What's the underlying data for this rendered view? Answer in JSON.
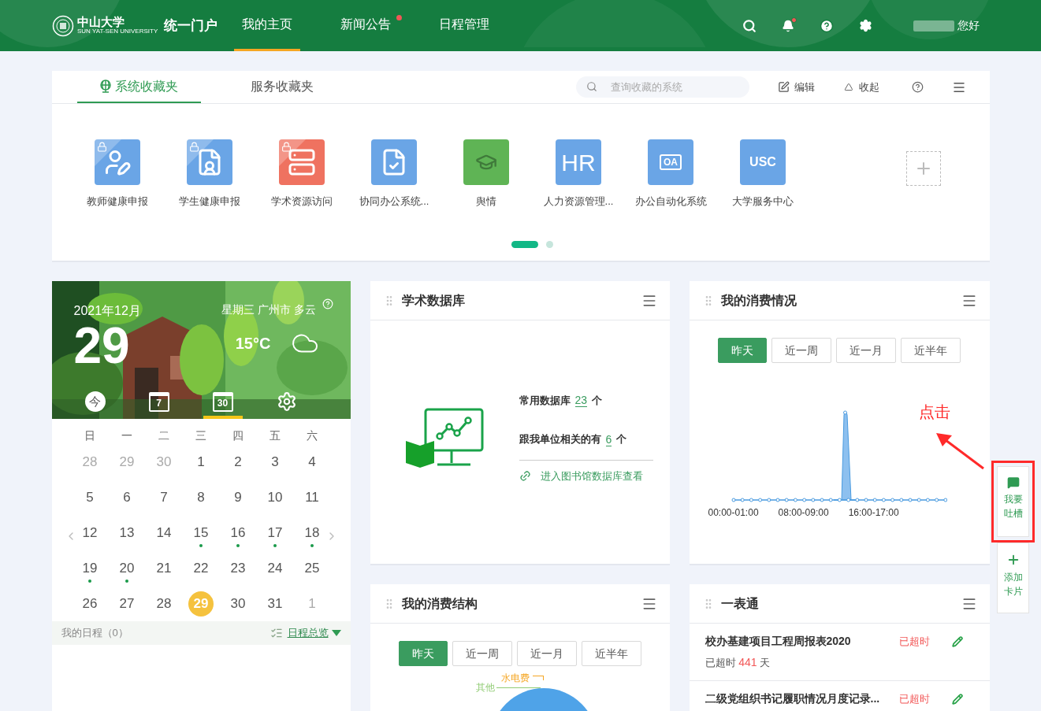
{
  "header": {
    "logo_name": "中山大学",
    "logo_subtitle": "SUN YAT-SEN UNIVERSITY",
    "portal_name": "统一门户",
    "nav": [
      {
        "label": "我的主页",
        "selected": true,
        "badge": false
      },
      {
        "label": "新闻公告",
        "selected": false,
        "badge": true
      },
      {
        "label": "日程管理",
        "selected": false,
        "badge": false
      }
    ],
    "tools": [
      {
        "kind": "search",
        "badge": false
      },
      {
        "kind": "bell",
        "badge": true
      },
      {
        "kind": "help",
        "badge": false
      },
      {
        "kind": "settings",
        "badge": false
      }
    ],
    "greeting": "您好"
  },
  "favorites": {
    "tabs": [
      {
        "label": "系统收藏夹",
        "selected": true
      },
      {
        "label": "服务收藏夹",
        "selected": false
      }
    ],
    "search_placeholder": "查询收藏的系统",
    "actions": [
      {
        "kind": "edit",
        "label": "编辑"
      },
      {
        "kind": "collapse",
        "label": "收起"
      }
    ],
    "apps": [
      {
        "label": "教师健康申报",
        "kind": "teacher",
        "color": "#6aa5e6",
        "locked": true
      },
      {
        "label": "学生健康申报",
        "kind": "student",
        "color": "#6aa5e6",
        "locked": true
      },
      {
        "label": "学术资源访问",
        "kind": "database",
        "color": "#ef7260",
        "locked": true
      },
      {
        "label": "协同办公系统...",
        "kind": "office",
        "color": "#6aa5e6",
        "locked": false
      },
      {
        "label": "舆情",
        "kind": "opinion",
        "color": "#5fb455",
        "locked": false
      },
      {
        "label": "人力资源管理...",
        "kind": "text",
        "glyph": "HR",
        "color": "#6aa5e6",
        "locked": false
      },
      {
        "label": "办公自动化系统",
        "kind": "screen",
        "glyph": "OA",
        "color": "#6aa5e6",
        "locked": false
      },
      {
        "label": "大学服务中心",
        "kind": "text",
        "glyph": "USC",
        "color": "#6aa5e6",
        "locked": false
      }
    ],
    "pages": [
      {
        "selected": true
      },
      {
        "selected": false
      }
    ]
  },
  "calendar": {
    "month": "2021年12月",
    "day": "29",
    "weekday": "星期三",
    "city": "广州市",
    "weather": "多云",
    "temperature": "15°C",
    "views": [
      {
        "kind": "today",
        "glyph": "今",
        "selected": false
      },
      {
        "kind": "week",
        "glyph": "7",
        "selected": false
      },
      {
        "kind": "month",
        "glyph": "30",
        "selected": true
      },
      {
        "kind": "settings",
        "selected": false
      }
    ],
    "weekdays": [
      "日",
      "一",
      "二",
      "三",
      "四",
      "五",
      "六"
    ],
    "weeks": [
      [
        {
          "label": "28",
          "muted": true,
          "dot": false,
          "selected": false
        },
        {
          "label": "29",
          "muted": true,
          "dot": false,
          "selected": false
        },
        {
          "label": "30",
          "muted": true,
          "dot": false,
          "selected": false
        },
        {
          "label": "1",
          "muted": false,
          "dot": false,
          "selected": false
        },
        {
          "label": "2",
          "muted": false,
          "dot": false,
          "selected": false
        },
        {
          "label": "3",
          "muted": false,
          "dot": false,
          "selected": false
        },
        {
          "label": "4",
          "muted": false,
          "dot": false,
          "selected": false
        }
      ],
      [
        {
          "label": "5",
          "muted": false,
          "dot": false,
          "selected": false
        },
        {
          "label": "6",
          "muted": false,
          "dot": false,
          "selected": false
        },
        {
          "label": "7",
          "muted": false,
          "dot": false,
          "selected": false
        },
        {
          "label": "8",
          "muted": false,
          "dot": false,
          "selected": false
        },
        {
          "label": "9",
          "muted": false,
          "dot": false,
          "selected": false
        },
        {
          "label": "10",
          "muted": false,
          "dot": false,
          "selected": false
        },
        {
          "label": "11",
          "muted": false,
          "dot": false,
          "selected": false
        }
      ],
      [
        {
          "label": "12",
          "muted": false,
          "dot": false,
          "selected": false
        },
        {
          "label": "13",
          "muted": false,
          "dot": false,
          "selected": false
        },
        {
          "label": "14",
          "muted": false,
          "dot": false,
          "selected": false
        },
        {
          "label": "15",
          "muted": false,
          "dot": true,
          "selected": false
        },
        {
          "label": "16",
          "muted": false,
          "dot": true,
          "selected": false
        },
        {
          "label": "17",
          "muted": false,
          "dot": true,
          "selected": false
        },
        {
          "label": "18",
          "muted": false,
          "dot": true,
          "selected": false
        }
      ],
      [
        {
          "label": "19",
          "muted": false,
          "dot": true,
          "selected": false
        },
        {
          "label": "20",
          "muted": false,
          "dot": true,
          "selected": false
        },
        {
          "label": "21",
          "muted": false,
          "dot": false,
          "selected": false
        },
        {
          "label": "22",
          "muted": false,
          "dot": false,
          "selected": false
        },
        {
          "label": "23",
          "muted": false,
          "dot": false,
          "selected": false
        },
        {
          "label": "24",
          "muted": false,
          "dot": false,
          "selected": false
        },
        {
          "label": "25",
          "muted": false,
          "dot": false,
          "selected": false
        }
      ],
      [
        {
          "label": "26",
          "muted": false,
          "dot": false,
          "selected": false
        },
        {
          "label": "27",
          "muted": false,
          "dot": false,
          "selected": false
        },
        {
          "label": "28",
          "muted": false,
          "dot": false,
          "selected": false
        },
        {
          "label": "29",
          "muted": false,
          "dot": false,
          "selected": true
        },
        {
          "label": "30",
          "muted": false,
          "dot": false,
          "selected": false
        },
        {
          "label": "31",
          "muted": false,
          "dot": false,
          "selected": false
        },
        {
          "label": "1",
          "muted": true,
          "dot": false,
          "selected": false
        }
      ]
    ],
    "schedule_label": "我的日程（0）",
    "overview_link": "日程总览"
  },
  "database": {
    "title": "学术数据库",
    "stats": [
      {
        "label": "常用数据库",
        "count": "23",
        "unit": "个"
      },
      {
        "label": "跟我单位相关的有",
        "count": "6",
        "unit": "个"
      }
    ],
    "link": "进入图书馆数据库查看"
  },
  "consumption": {
    "title": "我的消费情况",
    "ranges": [
      {
        "label": "昨天",
        "selected": true
      },
      {
        "label": "近一周",
        "selected": false
      },
      {
        "label": "近一月",
        "selected": false
      },
      {
        "label": "近半年",
        "selected": false
      }
    ],
    "x_labels": [
      "00:00-01:00",
      "08:00-09:00",
      "16:00-17:00"
    ]
  },
  "structure": {
    "title": "我的消费结构",
    "ranges": [
      {
        "label": "昨天",
        "selected": true
      },
      {
        "label": "近一周",
        "selected": false
      },
      {
        "label": "近一月",
        "selected": false
      },
      {
        "label": "近半年",
        "selected": false
      }
    ],
    "pie_labels": [
      {
        "label": "水电费",
        "color": "#f5a623"
      },
      {
        "label": "其他",
        "color": "#91cc75"
      }
    ]
  },
  "forms": {
    "title": "一表通",
    "items": [
      {
        "title": "校办基建项目工程周报表2020",
        "status": "已超时",
        "detail_prefix": "已超时",
        "detail_count": "441",
        "detail_unit": "天"
      },
      {
        "title": "二级党组织书记履职情况月度记录...",
        "status": "已超时"
      }
    ]
  },
  "side": [
    {
      "kind": "feedback",
      "label": "我要吐槽",
      "highlighted": true
    },
    {
      "kind": "add",
      "label": "添加卡片",
      "highlighted": false
    }
  ],
  "annotation": {
    "text": "点击"
  }
}
